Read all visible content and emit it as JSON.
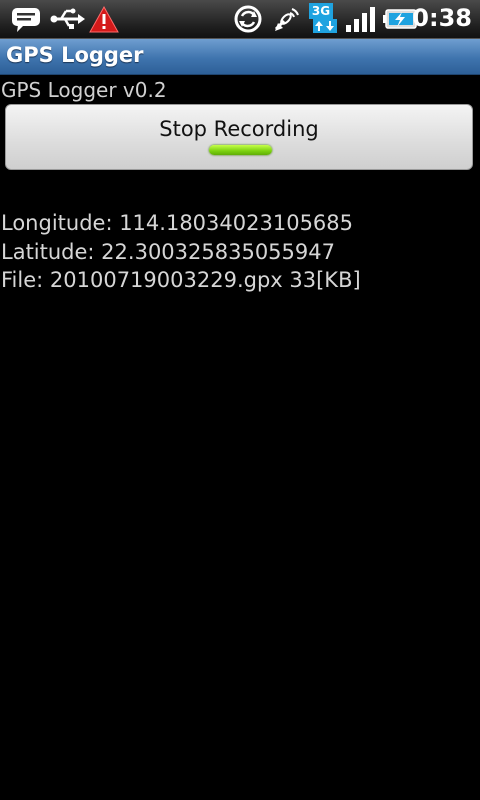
{
  "status_bar": {
    "time": "0:38",
    "network": "3G",
    "icons": [
      "message-icon",
      "usb-icon",
      "warning-icon",
      "sync-icon",
      "gps-signal-icon",
      "3g-data-icon",
      "signal-strength-icon",
      "battery-charging-icon"
    ]
  },
  "app": {
    "title": "GPS Logger",
    "version": "GPS Logger v0.2"
  },
  "record_button": {
    "label": "Stop Recording",
    "indicator_color": "#7bd10f"
  },
  "info": {
    "longitude": "Longitude: 114.18034023105685",
    "latitude": "Latitude: 22.300325835055947",
    "file": "File: 20100719003229.gpx 33[KB]"
  },
  "colors": {
    "title_bar": "#3f74ae",
    "background": "#000000"
  }
}
